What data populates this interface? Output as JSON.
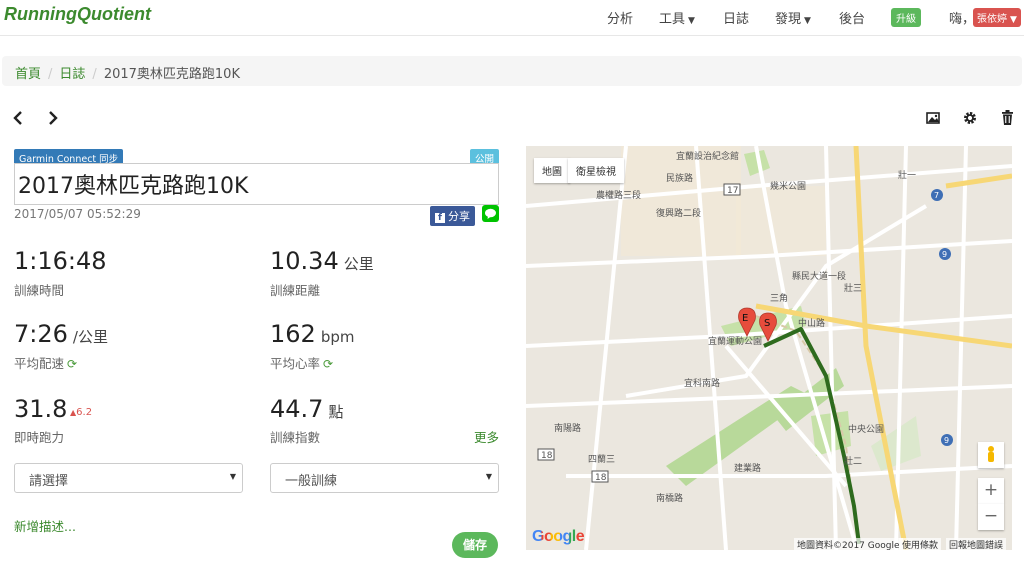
{
  "nav": {
    "brand": "RunningQuotient",
    "items": [
      "分析",
      "工具",
      "日誌",
      "發現",
      "後台"
    ],
    "upgrade": "升級",
    "greeting": "嗨，",
    "user": "張依婷"
  },
  "breadcrumb": [
    "首頁",
    "日誌",
    "2017奧林匹克路跑10K"
  ],
  "activity": {
    "garmin_badge": "Garmin Connect 同步",
    "public_badge": "公開",
    "title": "2017奧林匹克路跑10K",
    "datetime": "2017/05/07 05:52:29",
    "share": "分享"
  },
  "stats": {
    "duration": {
      "value": "1:16:48",
      "label": "訓練時間"
    },
    "distance": {
      "value": "10.34",
      "unit": "公里",
      "label": "訓練距離"
    },
    "pace": {
      "value": "7:26",
      "unit": "/公里",
      "label": "平均配速"
    },
    "heart_rate": {
      "value": "162",
      "unit": "bpm",
      "label": "平均心率"
    },
    "fitness": {
      "value": "31.8",
      "delta": "6.2",
      "label": "即時跑力"
    },
    "points": {
      "value": "44.7",
      "unit": "點",
      "label": "訓練指數"
    },
    "more": "更多"
  },
  "form": {
    "select1": "請選擇",
    "select2": "一般訓練",
    "add_desc": "新增描述...",
    "save": "儲存"
  },
  "map": {
    "type_map": "地圖",
    "type_satellite": "衛星檢視",
    "zoom_in": "+",
    "zoom_out": "−",
    "google": "Google",
    "footer": [
      "地圖資料©2017 Google",
      "使用條款",
      "回報地圖錯誤"
    ],
    "labels": {
      "memorial": "宜蘭設治紀念館",
      "park1": "幾米公園",
      "zhuang1": "壯一",
      "zhuang2": "壯二",
      "zhuang3": "壯三",
      "sanjiao": "三角",
      "stadium": "宜蘭運動公園",
      "central_park": "中央公園",
      "silan3": "四蘭三",
      "minzu": "民族路",
      "fuxing": "復興路二段",
      "zhongshan": "中山路",
      "xianzheng": "縣民大道一段",
      "jianye": "建業路",
      "nanqiao": "南橋路",
      "yiwen": "宜科南路",
      "nongquan": "農權路三段",
      "nanyang": "南陽路",
      "r17": "17",
      "r18": "18",
      "r7": "7",
      "r9": "9",
      "e": "E",
      "s": "S"
    }
  },
  "colors": {
    "accent": "#3c8a2e",
    "route": "#2e6b1e",
    "marker": "#e74c3c"
  },
  "icons": [
    "prev-arrow-icon",
    "next-arrow-icon",
    "image-icon",
    "gear-icon",
    "trash-icon",
    "sync-icon",
    "facebook-icon",
    "line-icon",
    "caret-down-icon",
    "delta-up-icon",
    "map-marker-icon",
    "pegman-icon"
  ]
}
